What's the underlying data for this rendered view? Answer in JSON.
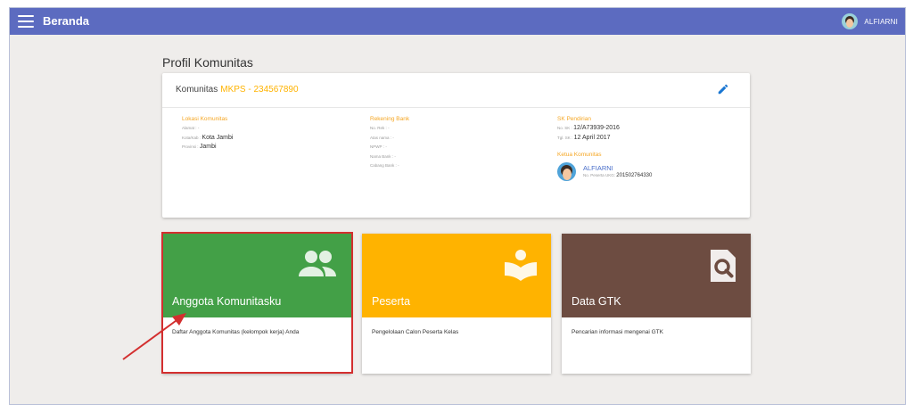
{
  "topbar": {
    "title": "Beranda",
    "menu_icon": "hamburger-menu-icon",
    "user_name": "ALFIARNI",
    "bar_color": "#5c6bc0"
  },
  "section_title": "Profil Komunitas",
  "profile": {
    "header_label": "Komunitas",
    "header_value": "MKPS - 234567890",
    "edit_icon": "pencil-icon",
    "lokasi": {
      "title": "Lokasi Komunitas",
      "alamat_label": "Alamat :",
      "alamat_value": "-",
      "kota_label": "Kota/Kab :",
      "kota_value": "Kota Jambi",
      "provinsi_label": "Provinsi :",
      "provinsi_value": "Jambi"
    },
    "rekening": {
      "title": "Rekening Bank",
      "norek_label": "No. Rek :",
      "norek_value": "-",
      "atas_nama_label": "Atas nama :",
      "atas_nama_value": "-",
      "npwp_label": "NPWP :",
      "npwp_value": "-",
      "nama_bank_label": "Nama Bank :",
      "nama_bank_value": "-",
      "cabang_label": "Cabang Bank :",
      "cabang_value": "-"
    },
    "sk": {
      "title": "SK Pendirian",
      "no_sk_label": "No. SK :",
      "no_sk_value": "12/A73939-2016",
      "tgl_sk_label": "Tgl. SK :",
      "tgl_sk_value": "12 April 2017"
    },
    "ketua": {
      "title": "Ketua Komunitas",
      "name": "ALFIARNI",
      "peserta_label": "No. Peserta UKG:",
      "peserta_value": "201502764330"
    }
  },
  "tiles": [
    {
      "title": "Anggota Komunitasku",
      "desc": "Daftar Anggota Komunitas (kelompok kerja) Anda",
      "icon": "people-icon",
      "color": "#43a047"
    },
    {
      "title": "Peserta",
      "desc": "Pengelolaan Calon Peserta Kelas",
      "icon": "reader-book-icon",
      "color": "#ffb300"
    },
    {
      "title": "Data GTK",
      "desc": "Pencarian informasi mengenai GTK",
      "icon": "file-search-icon",
      "color": "#6d4c41"
    }
  ],
  "annotation": {
    "highlight_color": "#d32f2f"
  }
}
